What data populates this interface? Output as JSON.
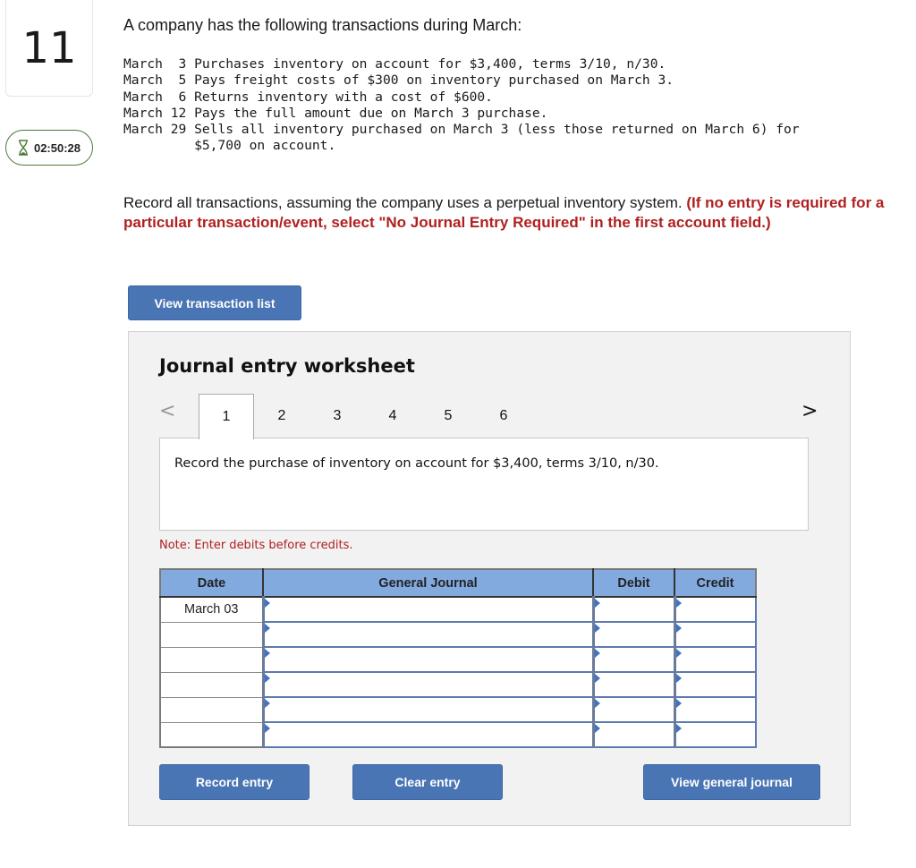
{
  "question": {
    "number": "11",
    "timer": {
      "icon": "hourglass-icon",
      "value": "02:50:28",
      "color": "#4c7a3a"
    },
    "prompt": "A company has the following transactions during March:",
    "transactions": [
      {
        "date": "March  3",
        "text": "Purchases inventory on account for $3,400, terms 3/10, n/30."
      },
      {
        "date": "March  5",
        "text": "Pays freight costs of $300 on inventory purchased on March 3."
      },
      {
        "date": "March  6",
        "text": "Returns inventory with a cost of $600."
      },
      {
        "date": "March 12",
        "text": "Pays the full amount due on March 3 purchase."
      },
      {
        "date": "March 29",
        "text": "Sells all inventory purchased on March 3 (less those returned on March 6) for\n         $5,700 on account."
      }
    ],
    "instruction": "Record all transactions, assuming the company uses a perpetual inventory system.",
    "instruction_emphasis": "(If no entry is required for a particular transaction/event, select \"No Journal Entry Required\" in the first account field.)"
  },
  "buttons": {
    "view_transaction_list": "View transaction list",
    "record_entry": "Record entry",
    "clear_entry": "Clear entry",
    "view_general_journal": "View general journal"
  },
  "worksheet": {
    "title": "Journal entry worksheet",
    "prev_icon": "chevron-left-icon",
    "next_icon": "chevron-right-icon",
    "prev_glyph": "<",
    "next_glyph": ">",
    "tabs": [
      "1",
      "2",
      "3",
      "4",
      "5",
      "6"
    ],
    "active_tab": "1",
    "description": "Record the purchase of inventory on account for $3,400, terms 3/10, n/30.",
    "note": "Note: Enter debits before credits.",
    "table": {
      "headers": {
        "date": "Date",
        "account": "General Journal",
        "debit": "Debit",
        "credit": "Credit"
      },
      "rows": [
        {
          "date": "March 03",
          "account": "",
          "debit": "",
          "credit": ""
        },
        {
          "date": "",
          "account": "",
          "debit": "",
          "credit": ""
        },
        {
          "date": "",
          "account": "",
          "debit": "",
          "credit": ""
        },
        {
          "date": "",
          "account": "",
          "debit": "",
          "credit": ""
        },
        {
          "date": "",
          "account": "",
          "debit": "",
          "credit": ""
        },
        {
          "date": "",
          "account": "",
          "debit": "",
          "credit": ""
        }
      ]
    }
  },
  "colors": {
    "button_bg": "#4a75b4",
    "header_bg": "#83aadf",
    "emphasis_red": "#b02020"
  }
}
